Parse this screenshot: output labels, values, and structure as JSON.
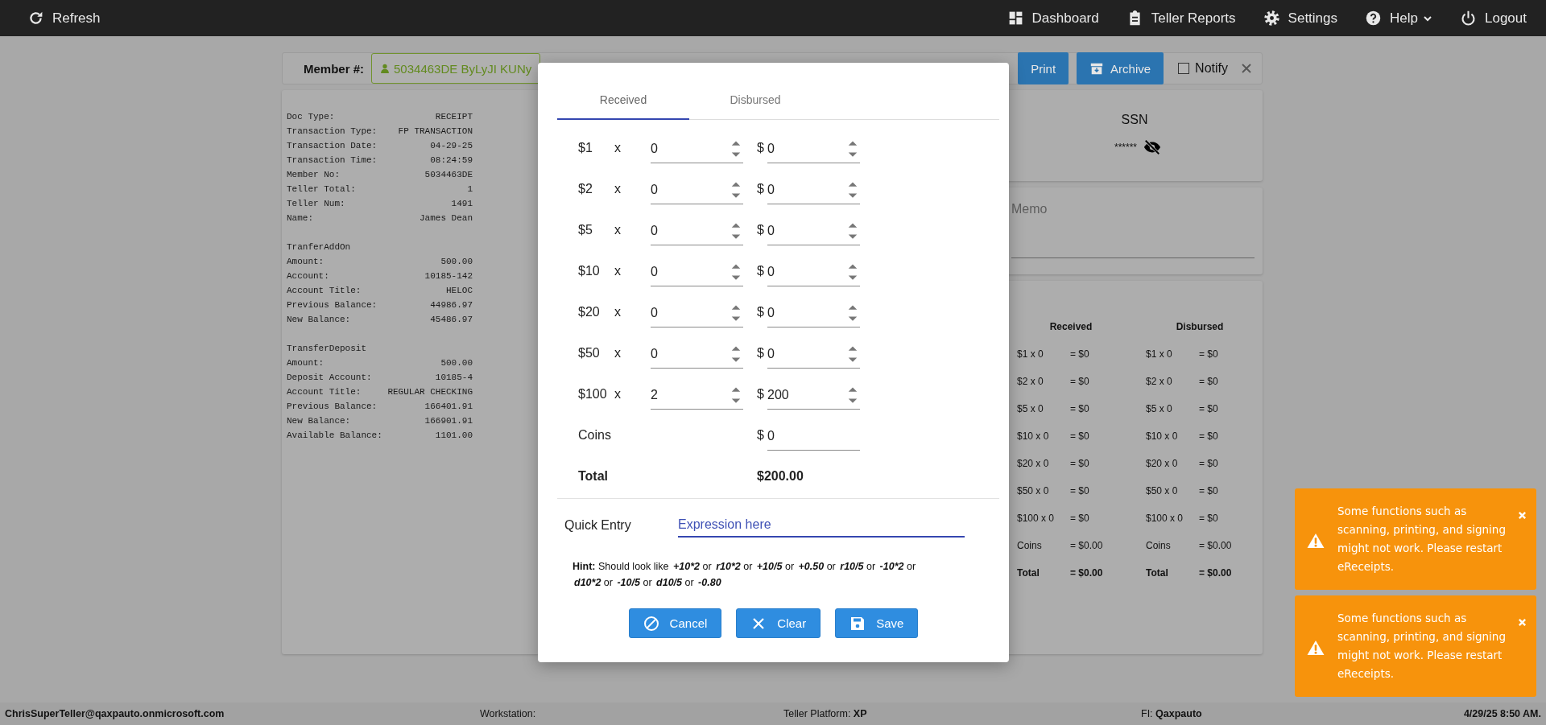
{
  "topbar": {
    "left": [
      {
        "label": "Refresh"
      }
    ],
    "right": [
      {
        "label": "Dashboard",
        "dropdown": false
      },
      {
        "label": "Teller Reports",
        "dropdown": false
      },
      {
        "label": "Settings",
        "dropdown": false
      },
      {
        "label": "Help",
        "dropdown": true
      },
      {
        "label": "Logout",
        "dropdown": false
      }
    ]
  },
  "member_bar": {
    "label": "Member #:",
    "member": "5034463DE ByLyJI KUNy",
    "buttons": [
      {
        "label": "Print"
      },
      {
        "label": "Archive"
      }
    ],
    "notify": {
      "label": "Notify",
      "checked": false
    }
  },
  "receipt": {
    "sections": [
      {
        "lines": [
          {
            "label": "Doc Type:",
            "value": "RECEIPT"
          },
          {
            "label": "Transaction Type:",
            "value": "FP TRANSACTION"
          },
          {
            "label": "Transaction Date:",
            "value": "04-29-25"
          },
          {
            "label": "Transaction Time:",
            "value": "08:24:59"
          },
          {
            "label": "Member No:",
            "value": "5034463DE"
          },
          {
            "label": "Teller Total:",
            "value": "1"
          },
          {
            "label": "Teller Num:",
            "value": "1491"
          },
          {
            "label": "Name:",
            "value": "James Dean"
          }
        ]
      },
      {
        "heading": "TranferAddOn",
        "lines": [
          {
            "label": "Amount:",
            "value": "500.00"
          },
          {
            "label": "Account:",
            "value": "10185-142"
          },
          {
            "label": "Account Title:",
            "value": "HELOC"
          },
          {
            "label": "Previous Balance:",
            "value": "44986.97"
          },
          {
            "label": "New Balance:",
            "value": "45486.97"
          }
        ]
      },
      {
        "heading": "TransferDeposit",
        "lines": [
          {
            "label": "Amount:",
            "value": "500.00"
          },
          {
            "label": "Deposit Account:",
            "value": "10185-4"
          },
          {
            "label": "Account Title:",
            "value": "REGULAR CHECKING"
          },
          {
            "label": "Previous Balance:",
            "value": "166401.91"
          },
          {
            "label": "New Balance:",
            "value": "166901.91"
          },
          {
            "label": "Available Balance:",
            "value": "1101.00"
          }
        ]
      }
    ]
  },
  "ssn": {
    "label": "SSN",
    "value": "******"
  },
  "memo": {
    "label": "Memo"
  },
  "summary": {
    "columns": [
      {
        "title": "Received",
        "rows": [
          {
            "item": "$1 x 0",
            "value": "= $0",
            "kind": "line"
          },
          {
            "item": "$2 x 0",
            "value": "= $0",
            "kind": "line"
          },
          {
            "item": "$5 x 0",
            "value": "= $0",
            "kind": "line"
          },
          {
            "item": "$10 x 0",
            "value": "= $0",
            "kind": "line"
          },
          {
            "item": "$20 x 0",
            "value": "= $0",
            "kind": "line"
          },
          {
            "item": "$50 x 0",
            "value": "= $0",
            "kind": "line"
          },
          {
            "item": "$100 x 0",
            "value": "= $0",
            "kind": "line"
          },
          {
            "item": "Coins",
            "value": "= $0.00",
            "kind": "line"
          },
          {
            "item": "Total",
            "value": "= $0.00",
            "kind": "total"
          }
        ]
      },
      {
        "title": "Disbursed",
        "rows": [
          {
            "item": "$1 x 0",
            "value": "= $0",
            "kind": "line"
          },
          {
            "item": "$2 x 0",
            "value": "= $0",
            "kind": "line"
          },
          {
            "item": "$5 x 0",
            "value": "= $0",
            "kind": "line"
          },
          {
            "item": "$10 x 0",
            "value": "= $0",
            "kind": "line"
          },
          {
            "item": "$20 x 0",
            "value": "= $0",
            "kind": "line"
          },
          {
            "item": "$50 x 0",
            "value": "= $0",
            "kind": "line"
          },
          {
            "item": "$100 x 0",
            "value": "= $0",
            "kind": "line"
          },
          {
            "item": "Coins",
            "value": "= $0.00",
            "kind": "line"
          },
          {
            "item": "Total",
            "value": "= $0.00",
            "kind": "total"
          }
        ]
      }
    ]
  },
  "modal": {
    "tabs": [
      {
        "label": "Received",
        "selected": true
      },
      {
        "label": "Disbursed",
        "selected": false
      }
    ],
    "rows": [
      {
        "denomination": "$1",
        "multiplier": "x",
        "count": "0",
        "currency": "$",
        "amount": "0"
      },
      {
        "denomination": "$2",
        "multiplier": "x",
        "count": "0",
        "currency": "$",
        "amount": "0"
      },
      {
        "denomination": "$5",
        "multiplier": "x",
        "count": "0",
        "currency": "$",
        "amount": "0"
      },
      {
        "denomination": "$10",
        "multiplier": "x",
        "count": "0",
        "currency": "$",
        "amount": "0"
      },
      {
        "denomination": "$20",
        "multiplier": "x",
        "count": "0",
        "currency": "$",
        "amount": "0"
      },
      {
        "denomination": "$50",
        "multiplier": "x",
        "count": "0",
        "currency": "$",
        "amount": "0"
      },
      {
        "denomination": "$100",
        "multiplier": "x",
        "count": "2",
        "currency": "$",
        "amount": "200"
      }
    ],
    "coins": {
      "label": "Coins",
      "currency": "$",
      "amount": "0"
    },
    "total": {
      "label": "Total",
      "value": "$200.00"
    },
    "quick_entry": {
      "label": "Quick Entry",
      "placeholder": "Expression here"
    },
    "hint": [
      {
        "text": "Hint:",
        "kind": "lead"
      },
      {
        "text": "Should look like",
        "kind": "plain"
      },
      {
        "text": "+10*2",
        "kind": "example"
      },
      {
        "text": "or",
        "kind": "plain"
      },
      {
        "text": "r10*2",
        "kind": "example"
      },
      {
        "text": "or",
        "kind": "plain"
      },
      {
        "text": "+10/5",
        "kind": "example"
      },
      {
        "text": "or",
        "kind": "plain"
      },
      {
        "text": "+0.50",
        "kind": "example"
      },
      {
        "text": "or",
        "kind": "plain"
      },
      {
        "text": "r10/5",
        "kind": "example"
      },
      {
        "text": "or",
        "kind": "plain"
      },
      {
        "text": "-10*2",
        "kind": "example"
      },
      {
        "text": "or",
        "kind": "plain"
      },
      {
        "text": "d10*2",
        "kind": "example"
      },
      {
        "text": "or",
        "kind": "plain"
      },
      {
        "text": "-10/5",
        "kind": "example"
      },
      {
        "text": "or",
        "kind": "plain"
      },
      {
        "text": "d10/5",
        "kind": "example"
      },
      {
        "text": "or",
        "kind": "plain"
      },
      {
        "text": "-0.80",
        "kind": "example"
      }
    ],
    "buttons": [
      {
        "label": "Cancel"
      },
      {
        "label": "Clear"
      },
      {
        "label": "Save"
      }
    ]
  },
  "toasts": [
    {
      "message": "Some functions such as scanning, printing, and signing might not work. Please restart eReceipts."
    },
    {
      "message": "Some functions such as scanning, printing, and signing might not work. Please restart eReceipts."
    }
  ],
  "status_bar": {
    "user": "ChrisSuperTeller@qaxpauto.onmicrosoft.com",
    "workstation": "Workstation:",
    "platform": "Teller Platform: **XP**",
    "fi": "FI: **Qaxpauto**",
    "datetime": "4/29/25 8:50 AM."
  }
}
